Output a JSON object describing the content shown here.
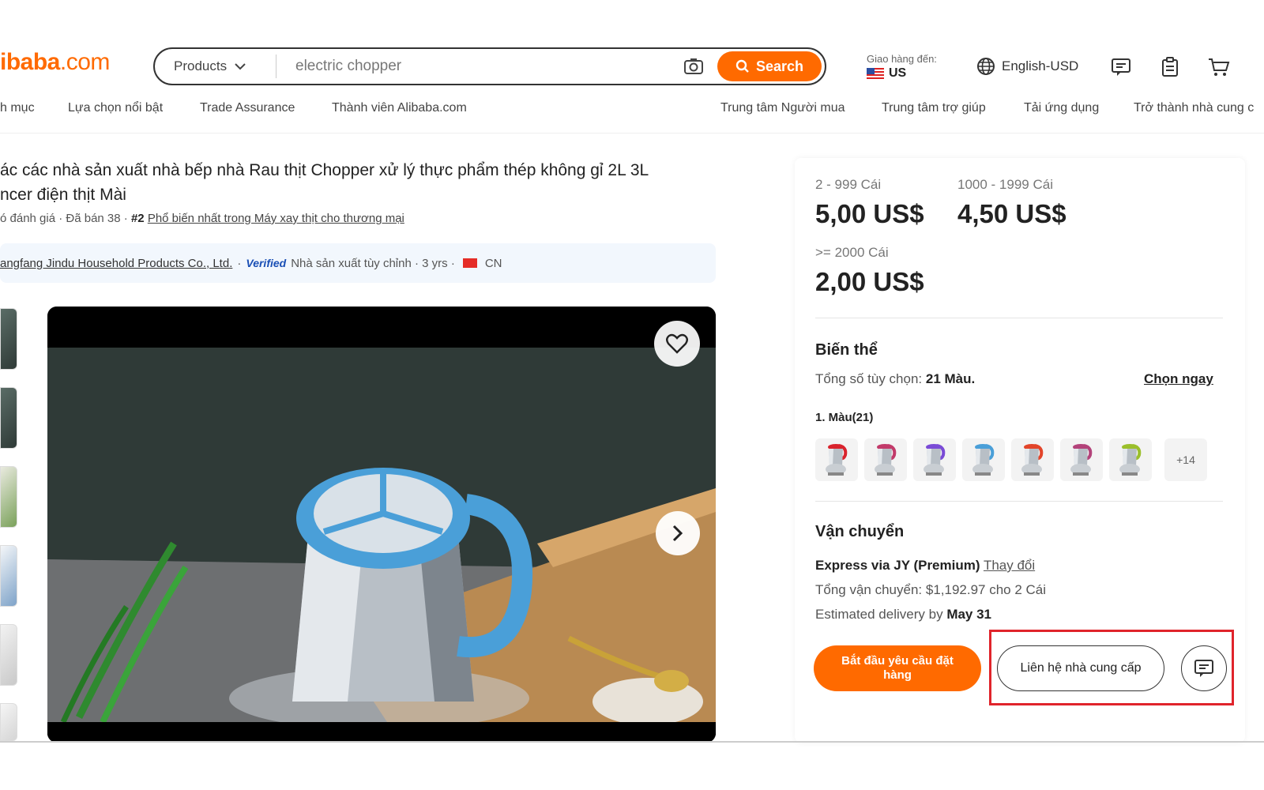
{
  "header": {
    "logo_text": "ibaba",
    "logo_suffix": ".com",
    "search": {
      "category": "Products",
      "value": "electric chopper",
      "button_label": "Search"
    },
    "deliver_label": "Giao hàng đến:",
    "deliver_country": "US",
    "language": "English-USD"
  },
  "subnav": {
    "left": [
      "h mục",
      "Lựa chọn nổi bật",
      "Trade Assurance",
      "Thành viên Alibaba.com"
    ],
    "right": [
      "Trung tâm Người mua",
      "Trung tâm trợ giúp",
      "Tải ứng dụng",
      "Trở thành nhà cung c"
    ]
  },
  "product": {
    "title_line1": "ác các nhà sản xuất nhà bếp nhà Rau thịt Chopper xử lý thực phẩm thép không gỉ 2L 3L",
    "title_line2": "ncer điện thịt Mài",
    "meta_prefix": "ó đánh giá · Đã bán 38 · ",
    "rank": "#2",
    "rank_link": "Phổ biến nhất trong Máy xay thịt cho thương mại",
    "supplier_name": "angfang Jindu Household Products Co., Ltd.",
    "verified": "Verified",
    "supplier_info": "Nhà sản xuất tùy chỉnh · 3 yrs ·",
    "supplier_country": "CN"
  },
  "pricing": {
    "tiers": [
      {
        "range": "2 - 999 Cái",
        "price": "5,00 US$"
      },
      {
        "range": "1000 - 1999 Cái",
        "price": "4,50 US$"
      },
      {
        "range": ">= 2000 Cái",
        "price": "2,00 US$"
      }
    ]
  },
  "variants": {
    "title": "Biến thể",
    "total_label": "Tổng số tùy chọn:",
    "total_value": "21 Màu.",
    "choose_now": "Chọn ngay",
    "color_label": "1. Màu(21)",
    "more": "+14",
    "swatch_colors": [
      "#d9232d",
      "#c23a6a",
      "#7a4bd6",
      "#4a9fd8",
      "#e2452a",
      "#b3437a",
      "#9bbf2c"
    ]
  },
  "shipping": {
    "title": "Vận chuyển",
    "method": "Express via JY (Premium)",
    "change": "Thay đổi",
    "total": "Tổng vận chuyển: $1,192.97 cho 2 Cái",
    "eta_label": "Estimated delivery by",
    "eta_date": "May 31"
  },
  "actions": {
    "order": "Bắt đầu yêu cầu đặt hàng",
    "contact": "Liên hệ nhà cung cấp"
  },
  "colors": {
    "accent": "#ff6a00",
    "highlight": "#e0242b"
  }
}
